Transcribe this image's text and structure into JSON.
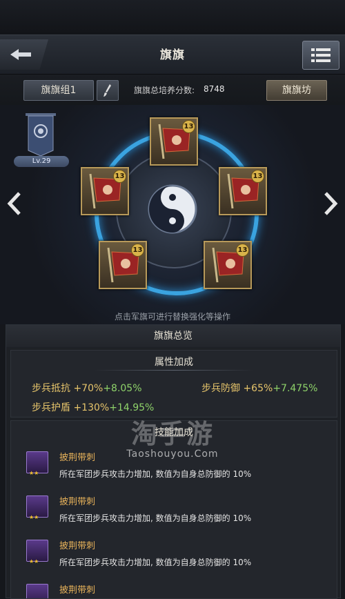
{
  "header": {
    "title": "旗旗"
  },
  "toolbar": {
    "group_label": "旗旗组1",
    "score_label": "旗旗总培养分数:",
    "score_value": "8748",
    "workshop_label": "旗旗坊"
  },
  "own_flag": {
    "level": "Lv.29"
  },
  "slots": [
    {
      "level": "13"
    },
    {
      "level": "13"
    },
    {
      "level": "13"
    },
    {
      "level": "13"
    },
    {
      "level": "13"
    }
  ],
  "hint": "点击军旗可进行替换强化等操作",
  "overview": {
    "title": "旗旗总览",
    "attr_title": "属性加成",
    "attributes": [
      {
        "name": "步兵抵抗 +70%",
        "bonus": "+8.05%"
      },
      {
        "name": "步兵防御 +65%",
        "bonus": "+7.475%"
      },
      {
        "name": "步兵护盾 +130%",
        "bonus": "+14.95%"
      }
    ],
    "skill_title": "技能加成",
    "skills": [
      {
        "name": "披荆带刺",
        "desc": "所在军团步兵攻击力增加, 数值为自身总防御的 10%",
        "stars": "★★"
      },
      {
        "name": "披荆带刺",
        "desc": "所在军团步兵攻击力增加, 数值为自身总防御的 10%",
        "stars": "★★"
      },
      {
        "name": "披荆带刺",
        "desc": "所在军团步兵攻击力增加, 数值为自身总防御的 10%",
        "stars": "★★"
      },
      {
        "name": "披荆带刺",
        "desc": "",
        "stars": "★★"
      }
    ]
  },
  "watermark": {
    "main": "淘手游",
    "sub": "Taoshouyou.Com"
  },
  "colors": {
    "ring": "#3aa3e0",
    "gold": "#e7c56b",
    "green": "#8fd36a",
    "skill_name": "#e7b25a"
  },
  "icons": {
    "back": "back-arrow-icon",
    "menu": "list-menu-icon",
    "brush": "brush-icon",
    "left": "chevron-left-icon",
    "right": "chevron-right-icon",
    "center": "yin-yang-icon"
  }
}
